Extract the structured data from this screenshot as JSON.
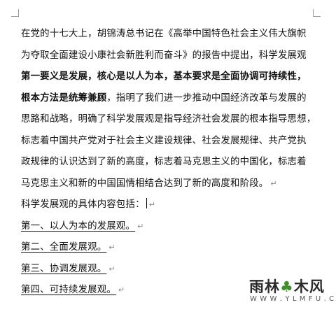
{
  "document": {
    "lines": [
      {
        "text": "在党的十七大上，胡锦涛总书记在《高举中国特色社会主义伟大旗帜"
      },
      {
        "text": "为夺取全面建设小康社会新胜利而奋斗》的报告中提出，科学发展观"
      },
      {
        "text": "第一要义是发展，核心是以人为本，基本要求是全面协调可持续性，"
      },
      {
        "text_bold": "根本方法是统筹兼顾",
        "text_rest": "，指明了我们进一步推动中国经济改革与发展的"
      },
      {
        "text": "思路和战略，明确了科学发展观是指导经济社会发展的根本指导思想，"
      },
      {
        "text": "标志着中国共产党对于社会主义建设规律、社会发展规律、共产党执"
      },
      {
        "text": "政规律的认识达到了新的高度，标志着马克思主义的中国化，标志着"
      },
      {
        "text": "马克思主义和新的中国国情相结合达到了新的高度和阶段。",
        "mark": "↵"
      },
      {
        "text": "科学发展观的具体内容包括：",
        "mark": "↵"
      },
      {
        "text": "第一、以人为本的发展观。",
        "mark": "↵"
      },
      {
        "text": "第二、全面发展观。",
        "mark": "↵"
      },
      {
        "text": "第三、协调发展观。",
        "mark": "↵"
      },
      {
        "text": "第四、可持续发展观。",
        "mark": "↵"
      }
    ]
  },
  "watermark": {
    "part1": "雨林",
    "part2": "木风",
    "url": "W W W . Y L M F U . C O M"
  }
}
